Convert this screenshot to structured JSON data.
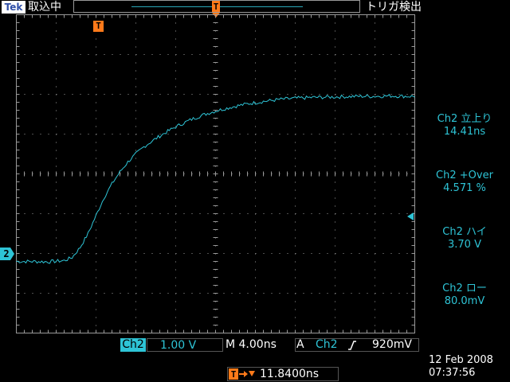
{
  "header": {
    "logo": "Tek",
    "acquisition_status": "取込中",
    "trigger_status": "トリガ検出"
  },
  "markers": {
    "trigger_time_marker": "T",
    "channel_ground_marker": "2"
  },
  "measurements": [
    {
      "label": "Ch2 立上り",
      "value": "14.41ns"
    },
    {
      "label": "Ch2 +Over",
      "value": "4.571 %"
    },
    {
      "label": "Ch2 ハイ",
      "value": "3.70 V"
    },
    {
      "label": "Ch2 ロー",
      "value": "80.0mV"
    }
  ],
  "bottom": {
    "channel_label": "Ch2",
    "channel_scale": "1.00 V",
    "timebase": "M 4.00ns",
    "trigger_mode": "A",
    "trigger_source": "Ch2",
    "trigger_level": "920mV",
    "delay": "11.8400ns",
    "date": "12 Feb  2008",
    "time": "07:37:56"
  },
  "colors": {
    "trace": "#2ec4d6",
    "graticule": "#9a9a9a",
    "marker": "#ff7a1a"
  },
  "chart_data": {
    "type": "line",
    "x_unit": "div",
    "y_unit": "div",
    "xlim": [
      -5,
      5
    ],
    "ylim": [
      -4,
      4
    ],
    "grid": true,
    "series": [
      {
        "x": [
          -5.0,
          -4.6,
          -4.2,
          -3.8,
          -3.6,
          -3.4,
          -3.2,
          -3.0,
          -2.8,
          -2.6,
          -2.4,
          -2.2,
          -2.0,
          -1.8,
          -1.6,
          -1.4,
          -1.2,
          -1.0,
          -0.8,
          -0.6,
          -0.4,
          -0.2,
          0.0,
          0.4,
          0.8,
          1.2,
          1.6,
          2.0,
          2.4,
          2.8,
          3.2,
          3.6,
          4.0,
          4.4,
          4.8,
          5.0
        ],
        "y": [
          -2.2,
          -2.2,
          -2.21,
          -2.18,
          -2.1,
          -1.85,
          -1.5,
          -1.05,
          -0.6,
          -0.25,
          0.05,
          0.3,
          0.5,
          0.68,
          0.82,
          0.95,
          1.07,
          1.18,
          1.28,
          1.37,
          1.45,
          1.52,
          1.58,
          1.68,
          1.76,
          1.82,
          1.87,
          1.9,
          1.92,
          1.93,
          1.94,
          1.95,
          1.95,
          1.96,
          1.95,
          1.95
        ]
      }
    ]
  }
}
